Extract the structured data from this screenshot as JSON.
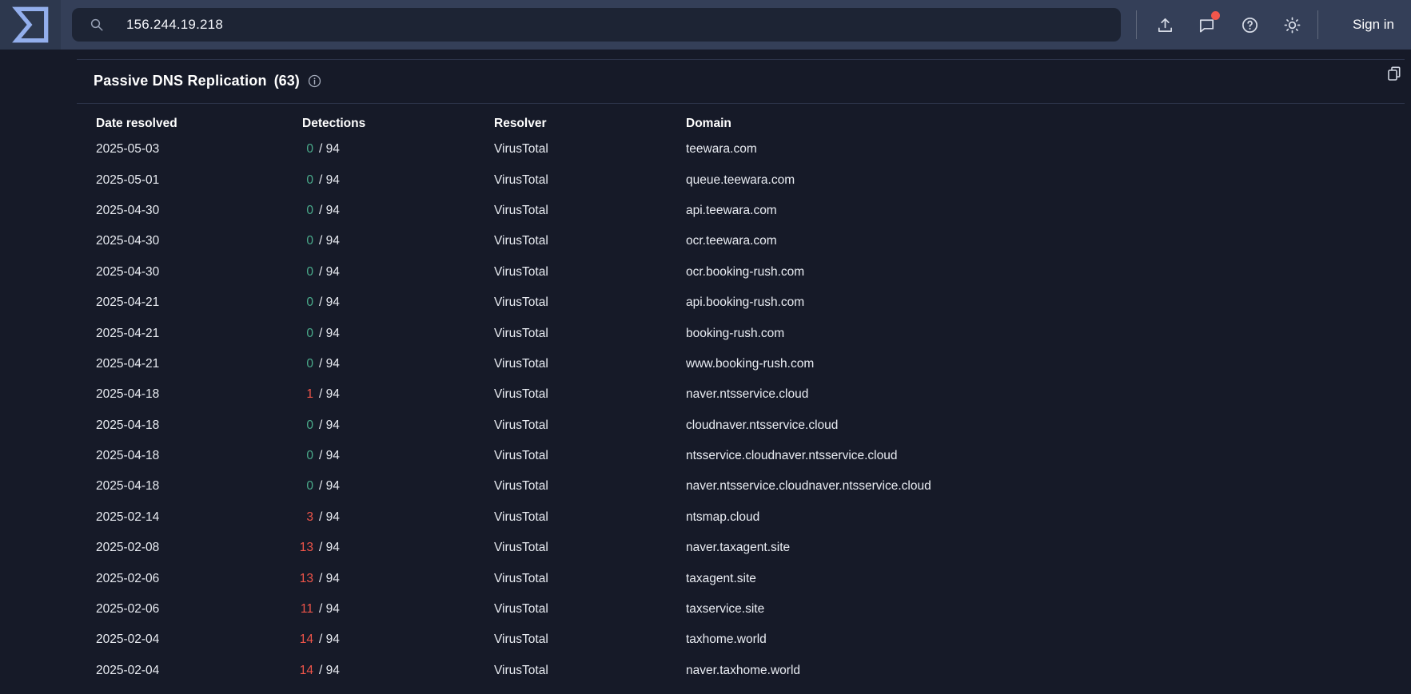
{
  "header": {
    "search_value": "156.244.19.218",
    "sign_in_label": "Sign in",
    "icons": [
      "search-icon",
      "upload-icon",
      "feedback-icon",
      "help-icon",
      "theme-toggle-icon"
    ]
  },
  "section": {
    "title": "Passive DNS Replication",
    "count": "(63)",
    "info_icon": "info-icon",
    "copy_icon": "copy-icon"
  },
  "colors": {
    "clean": "#4aab8b",
    "malicious": "#ee5449",
    "topbar": "#343f58",
    "background": "#161a28"
  },
  "table": {
    "columns": [
      "Date resolved",
      "Detections",
      "Resolver",
      "Domain"
    ],
    "detections_total": "94",
    "rows": [
      {
        "date": "2025-05-03",
        "detections": "0",
        "resolver": "VirusTotal",
        "domain": "teewara.com"
      },
      {
        "date": "2025-05-01",
        "detections": "0",
        "resolver": "VirusTotal",
        "domain": "queue.teewara.com"
      },
      {
        "date": "2025-04-30",
        "detections": "0",
        "resolver": "VirusTotal",
        "domain": "api.teewara.com"
      },
      {
        "date": "2025-04-30",
        "detections": "0",
        "resolver": "VirusTotal",
        "domain": "ocr.teewara.com"
      },
      {
        "date": "2025-04-30",
        "detections": "0",
        "resolver": "VirusTotal",
        "domain": "ocr.booking-rush.com"
      },
      {
        "date": "2025-04-21",
        "detections": "0",
        "resolver": "VirusTotal",
        "domain": "api.booking-rush.com"
      },
      {
        "date": "2025-04-21",
        "detections": "0",
        "resolver": "VirusTotal",
        "domain": "booking-rush.com"
      },
      {
        "date": "2025-04-21",
        "detections": "0",
        "resolver": "VirusTotal",
        "domain": "www.booking-rush.com"
      },
      {
        "date": "2025-04-18",
        "detections": "1",
        "resolver": "VirusTotal",
        "domain": "naver.ntsservice.cloud"
      },
      {
        "date": "2025-04-18",
        "detections": "0",
        "resolver": "VirusTotal",
        "domain": "cloudnaver.ntsservice.cloud"
      },
      {
        "date": "2025-04-18",
        "detections": "0",
        "resolver": "VirusTotal",
        "domain": "ntsservice.cloudnaver.ntsservice.cloud"
      },
      {
        "date": "2025-04-18",
        "detections": "0",
        "resolver": "VirusTotal",
        "domain": "naver.ntsservice.cloudnaver.ntsservice.cloud"
      },
      {
        "date": "2025-02-14",
        "detections": "3",
        "resolver": "VirusTotal",
        "domain": "ntsmap.cloud"
      },
      {
        "date": "2025-02-08",
        "detections": "13",
        "resolver": "VirusTotal",
        "domain": "naver.taxagent.site"
      },
      {
        "date": "2025-02-06",
        "detections": "13",
        "resolver": "VirusTotal",
        "domain": "taxagent.site"
      },
      {
        "date": "2025-02-06",
        "detections": "11",
        "resolver": "VirusTotal",
        "domain": "taxservice.site"
      },
      {
        "date": "2025-02-04",
        "detections": "14",
        "resolver": "VirusTotal",
        "domain": "taxhome.world"
      },
      {
        "date": "2025-02-04",
        "detections": "14",
        "resolver": "VirusTotal",
        "domain": "naver.taxhome.world"
      }
    ]
  }
}
